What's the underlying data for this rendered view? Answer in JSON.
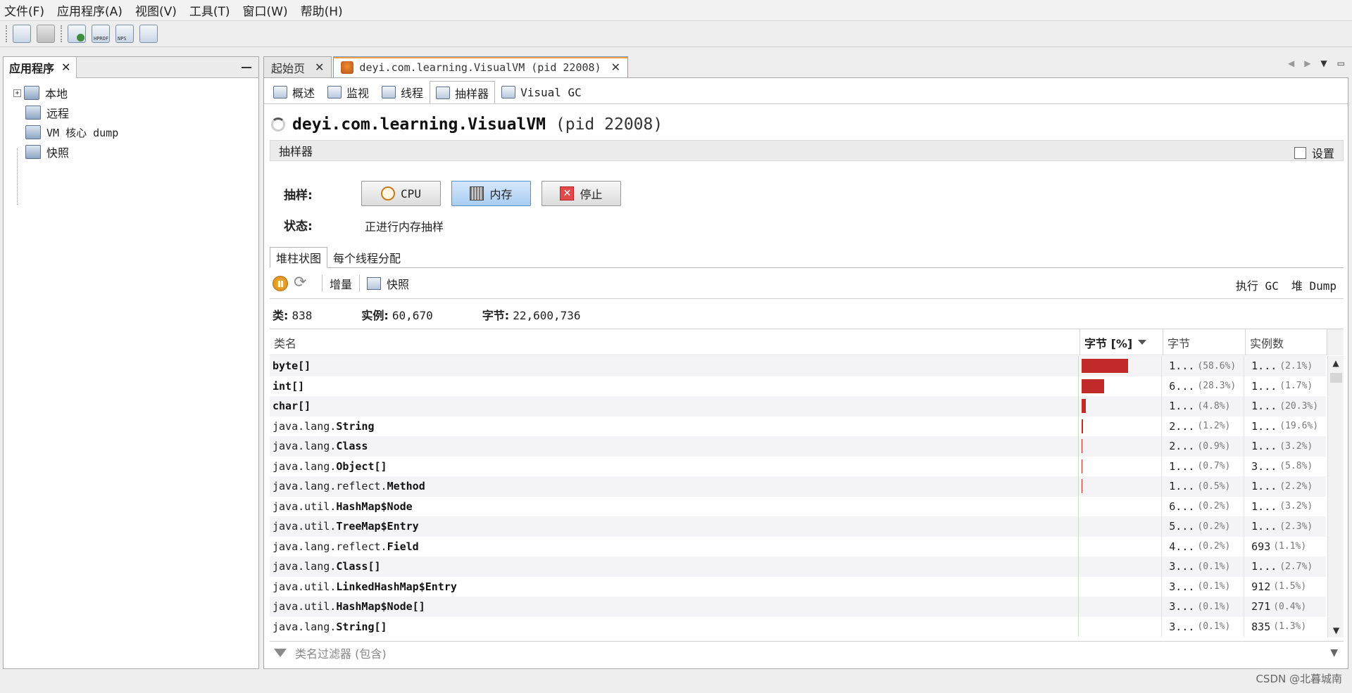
{
  "menu": [
    "文件(F)",
    "应用程序(A)",
    "视图(V)",
    "工具(T)",
    "窗口(W)",
    "帮助(H)"
  ],
  "toolbar_icons": [
    "open-icon",
    "save-icon",
    "add-jmx-icon",
    "load-dump-icon",
    "load-snapshot-icon",
    "add-remote-host-icon"
  ],
  "left_panel": {
    "tab_title": "应用程序",
    "close": "✕",
    "tree": [
      {
        "label": "本地",
        "icon": "computer-icon"
      },
      {
        "label": "远程",
        "icon": "network-icon"
      },
      {
        "label": "VM 核心 dump",
        "icon": "dump-icon"
      },
      {
        "label": "快照",
        "icon": "snapshot-icon"
      }
    ]
  },
  "doc_tabs": [
    {
      "label": "起始页",
      "close": "✕"
    },
    {
      "label": "deyi.com.learning.VisualVM (pid 22008)",
      "close": "✕"
    }
  ],
  "sub_tabs": [
    "概述",
    "监视",
    "线程",
    "抽样器",
    "Visual GC"
  ],
  "title": {
    "name": "deyi.com.learning.VisualVM",
    "pid": "(pid 22008)"
  },
  "sampler": {
    "header": "抽样器",
    "settings_label": "设置",
    "sample_label": "抽样:",
    "buttons": {
      "cpu": "CPU",
      "memory": "内存",
      "stop": "停止"
    },
    "status_label": "状态:",
    "status_value": "正进行内存抽样"
  },
  "inner_tabs": [
    "堆柱状图",
    "每个线程分配"
  ],
  "results_toolbar": {
    "delta": "增量",
    "snapshot": "快照",
    "gc": "执行 GC",
    "heap_dump": "堆 Dump"
  },
  "summary": {
    "classes_label": "类:",
    "classes": "838",
    "instances_label": "实例:",
    "instances": "60,670",
    "bytes_label": "字节:",
    "bytes": "22,600,736"
  },
  "table": {
    "headers": [
      "类名",
      "字节 [%]",
      "字节",
      "实例数"
    ],
    "bar_color": "#c12a2a",
    "rows": [
      {
        "pkg": "",
        "cls": "byte[]",
        "pct": 58.6,
        "bytes": "1...",
        "bytes_pct": "(58.6%)",
        "inst": "1...",
        "inst_pct": "(2.1%)"
      },
      {
        "pkg": "",
        "cls": "int[]",
        "pct": 28.3,
        "bytes": "6...",
        "bytes_pct": "(28.3%)",
        "inst": "1...",
        "inst_pct": "(1.7%)"
      },
      {
        "pkg": "",
        "cls": "char[]",
        "pct": 4.8,
        "bytes": "1...",
        "bytes_pct": "(4.8%)",
        "inst": "1...",
        "inst_pct": "(20.3%)"
      },
      {
        "pkg": "java.lang.",
        "cls": "String",
        "pct": 1.2,
        "bytes": "2...",
        "bytes_pct": "(1.2%)",
        "inst": "1...",
        "inst_pct": "(19.6%)"
      },
      {
        "pkg": "java.lang.",
        "cls": "Class",
        "pct": 0.9,
        "bytes": "2...",
        "bytes_pct": "(0.9%)",
        "inst": "1...",
        "inst_pct": "(3.2%)"
      },
      {
        "pkg": "java.lang.",
        "cls": "Object[]",
        "pct": 0.7,
        "bytes": "1...",
        "bytes_pct": "(0.7%)",
        "inst": "3...",
        "inst_pct": "(5.8%)"
      },
      {
        "pkg": "java.lang.reflect.",
        "cls": "Method",
        "pct": 0.5,
        "bytes": "1...",
        "bytes_pct": "(0.5%)",
        "inst": "1...",
        "inst_pct": "(2.2%)"
      },
      {
        "pkg": "java.util.",
        "cls": "HashMap$Node",
        "pct": 0.2,
        "bytes": "6...",
        "bytes_pct": "(0.2%)",
        "inst": "1...",
        "inst_pct": "(3.2%)"
      },
      {
        "pkg": "java.util.",
        "cls": "TreeMap$Entry",
        "pct": 0.2,
        "bytes": "5...",
        "bytes_pct": "(0.2%)",
        "inst": "1...",
        "inst_pct": "(2.3%)"
      },
      {
        "pkg": "java.lang.reflect.",
        "cls": "Field",
        "pct": 0.2,
        "bytes": "4...",
        "bytes_pct": "(0.2%)",
        "inst": "693",
        "inst_pct": "(1.1%)"
      },
      {
        "pkg": "java.lang.",
        "cls": "Class[]",
        "pct": 0.1,
        "bytes": "3...",
        "bytes_pct": "(0.1%)",
        "inst": "1...",
        "inst_pct": "(2.7%)"
      },
      {
        "pkg": "java.util.",
        "cls": "LinkedHashMap$Entry",
        "pct": 0.1,
        "bytes": "3...",
        "bytes_pct": "(0.1%)",
        "inst": "912",
        "inst_pct": "(1.5%)"
      },
      {
        "pkg": "java.util.",
        "cls": "HashMap$Node[]",
        "pct": 0.1,
        "bytes": "3...",
        "bytes_pct": "(0.1%)",
        "inst": "271",
        "inst_pct": "(0.4%)"
      },
      {
        "pkg": "java.lang.",
        "cls": "String[]",
        "pct": 0.1,
        "bytes": "3...",
        "bytes_pct": "(0.1%)",
        "inst": "835",
        "inst_pct": "(1.3%)"
      }
    ]
  },
  "filter_placeholder": "类名过滤器 (包含)",
  "watermark": "CSDN @北暮城南"
}
